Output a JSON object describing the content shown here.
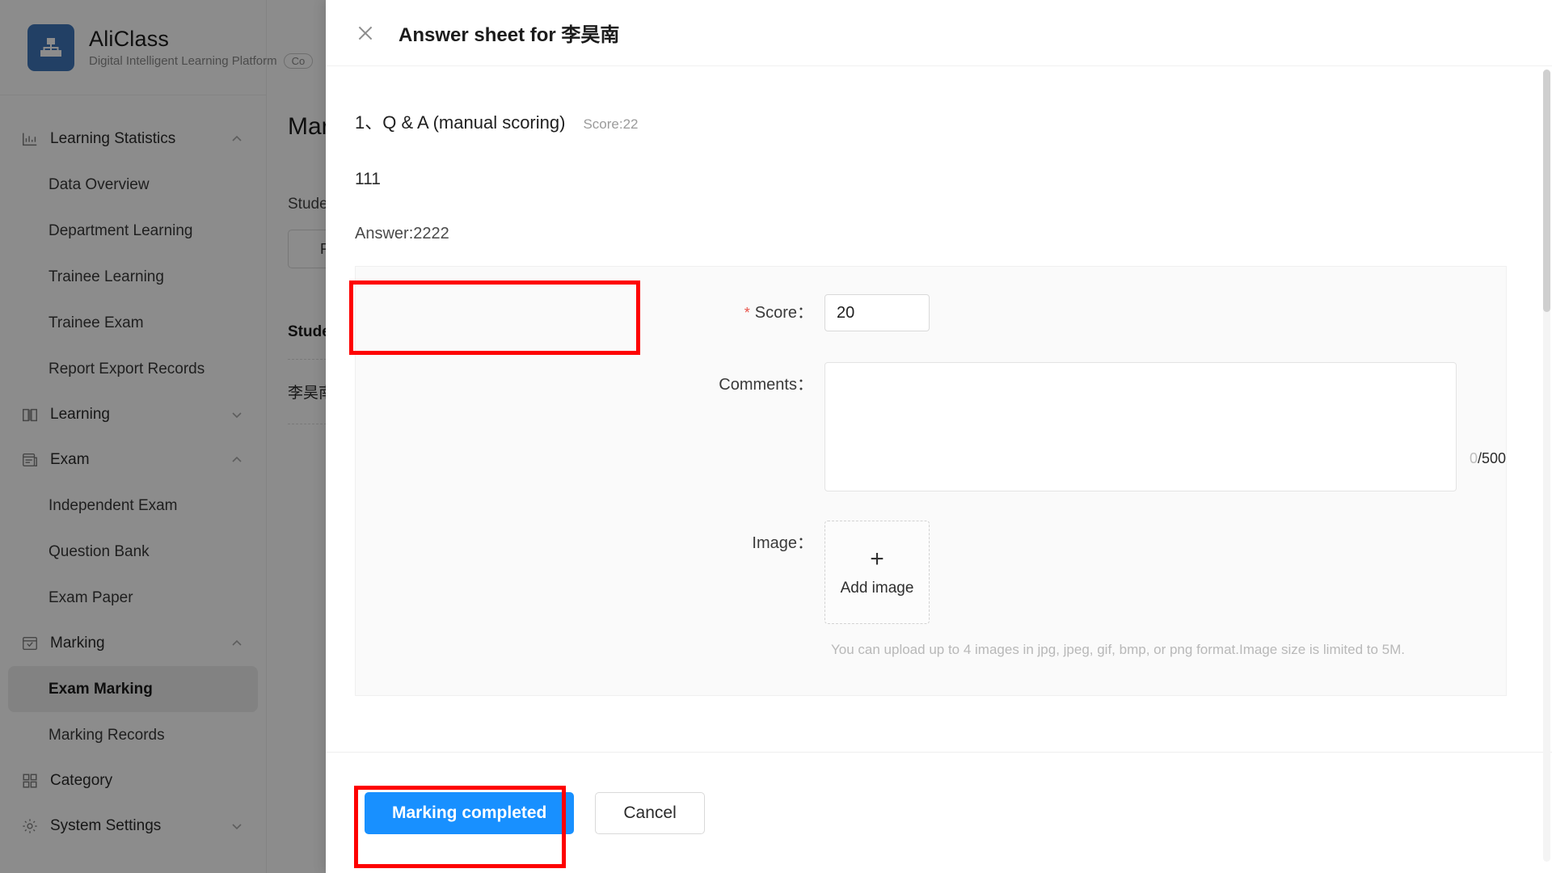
{
  "brand": {
    "name": "AliClass",
    "subtitle": "Digital Intelligent Learning Platform",
    "chip": "Co",
    "logo_icon": "org-chart-icon"
  },
  "sidebar": {
    "groups": [
      {
        "label": "Learning Statistics",
        "icon": "bar-chart-icon",
        "expanded": true,
        "chevron": "chevron-up",
        "items": [
          {
            "label": "Data Overview",
            "active": false
          },
          {
            "label": "Department Learning",
            "active": false
          },
          {
            "label": "Trainee Learning",
            "active": false
          },
          {
            "label": "Trainee Exam",
            "active": false
          },
          {
            "label": "Report Export Records",
            "active": false
          }
        ]
      },
      {
        "label": "Learning",
        "icon": "book-icon",
        "expanded": false,
        "chevron": "chevron-down",
        "items": []
      },
      {
        "label": "Exam",
        "icon": "exam-paper-icon",
        "expanded": true,
        "chevron": "chevron-up",
        "items": [
          {
            "label": "Independent Exam",
            "active": false
          },
          {
            "label": "Question Bank",
            "active": false
          },
          {
            "label": "Exam Paper",
            "active": false
          }
        ]
      },
      {
        "label": "Marking",
        "icon": "marking-check-icon",
        "expanded": true,
        "chevron": "chevron-up",
        "items": [
          {
            "label": "Exam Marking",
            "active": true
          },
          {
            "label": "Marking Records",
            "active": false
          }
        ]
      },
      {
        "label": "Category",
        "icon": "grid-icon",
        "expanded": false,
        "chevron": "",
        "items": []
      },
      {
        "label": "System Settings",
        "icon": "gear-icon",
        "expanded": false,
        "chevron": "chevron-down",
        "items": []
      }
    ]
  },
  "background_page": {
    "title": "Marki",
    "filter_label": "Studen",
    "reset_button": "Res",
    "table_header": "Studen",
    "table_row": "李昊南"
  },
  "modal": {
    "close_icon": "close-icon",
    "title": "Answer sheet for 李昊南",
    "question": {
      "number_title": "1、Q & A (manual scoring)",
      "score_label": "Score:22",
      "stem": "111",
      "answer": "Answer:2222"
    },
    "form": {
      "score": {
        "required_mark": "*",
        "label": "Score：",
        "value": "20"
      },
      "comments": {
        "label": "Comments：",
        "value": "",
        "placeholder": "",
        "counter_current": "0",
        "counter_sep": "/500"
      },
      "image": {
        "label": "Image：",
        "add_plus": "+",
        "add_label": "Add image",
        "hint": "You can upload up to 4 images in jpg, jpeg, gif, bmp, or png format.Image size is limited to 5M."
      }
    },
    "footer": {
      "submit_label": "Marking completed",
      "cancel_label": "Cancel"
    }
  },
  "annotations": {
    "highlight_color": "#fe0000",
    "boxes": [
      "score-field",
      "marking-completed-button"
    ]
  },
  "colors": {
    "primary": "#1890ff",
    "brand_logo": "#3f76b8",
    "required_red": "#e8544a",
    "annotation_red": "#fe0000"
  }
}
